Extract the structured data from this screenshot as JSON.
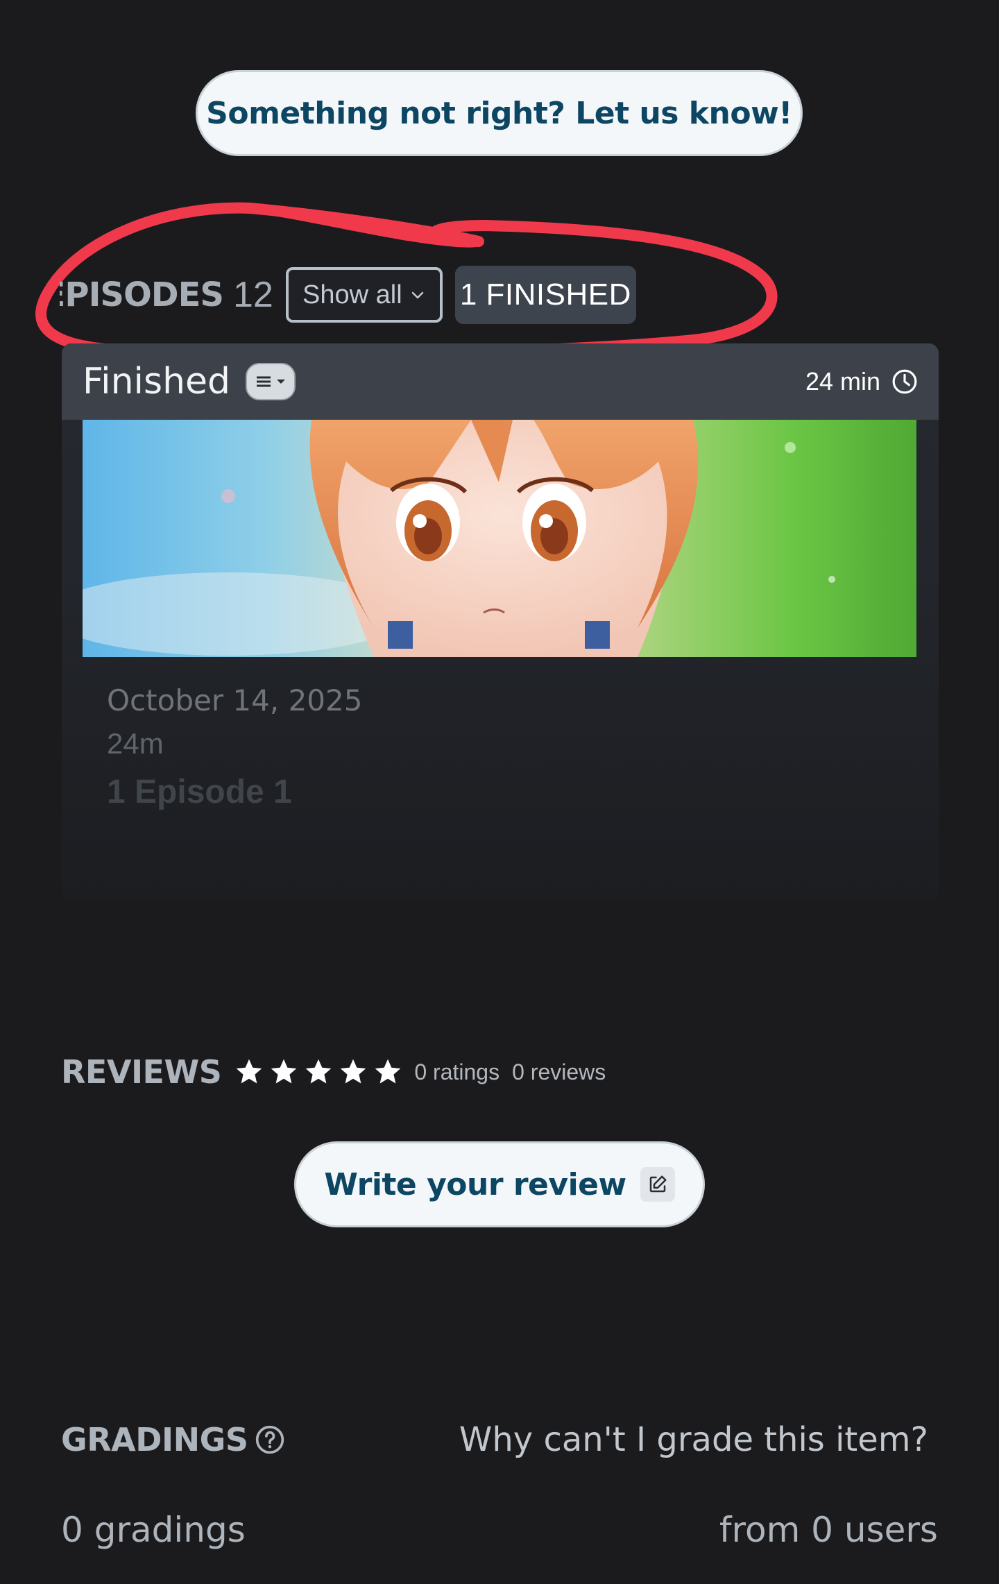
{
  "feedback": {
    "label": "Something not right? Let us know!"
  },
  "episodes": {
    "title": "EPISODES",
    "count": "12",
    "filter": {
      "selected": "Show all"
    },
    "finished_badge": "1 FINISHED"
  },
  "episode_card": {
    "header_title": "Finished",
    "duration": "24 min",
    "date": "October 14, 2025",
    "length": "24m",
    "title": "1 Episode 1"
  },
  "reviews": {
    "title": "REVIEWS",
    "ratings": "0 ratings",
    "reviews": "0 reviews",
    "stars_total": 5,
    "write_label": "Write your review"
  },
  "gradings": {
    "title": "GRADINGS",
    "why_link": "Why can't I grade this item?",
    "count": "0 gradings",
    "users": "from 0 users"
  },
  "colors": {
    "background": "#1b1b1e",
    "accent_text": "#0c4663",
    "annotation": "#f03a4c"
  }
}
